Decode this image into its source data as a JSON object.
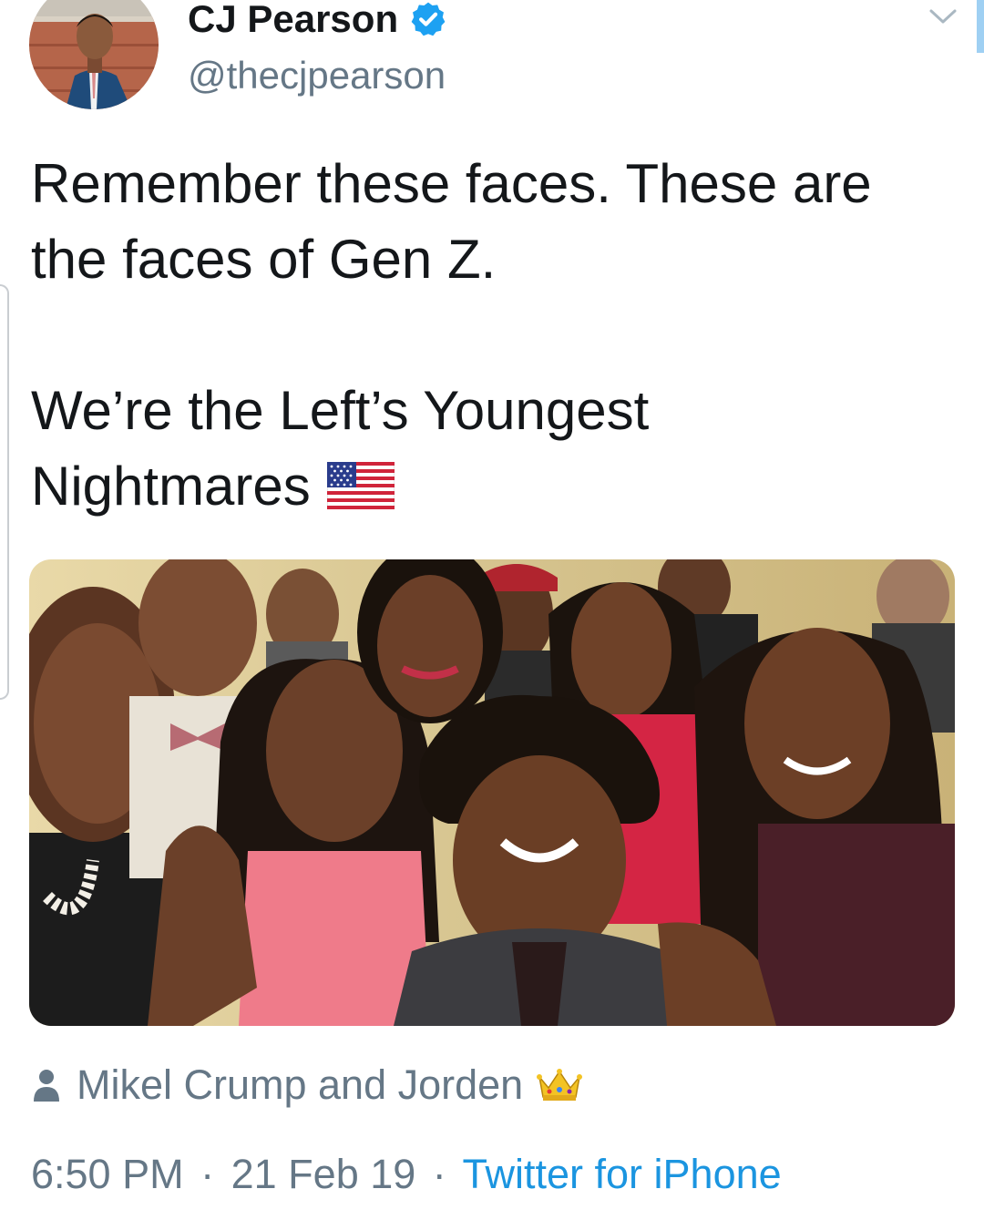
{
  "header": {
    "display_name": "CJ Pearson",
    "handle": "@thecjpearson",
    "avatar_icon": "profile-photo",
    "verified_icon": "verified-badge-icon",
    "menu_icon": "chevron-down-icon"
  },
  "tweet": {
    "line1": "Remember these faces. These are",
    "line2": "the faces of Gen Z.",
    "line3": "We’re the Left’s Youngest",
    "line4": "Nightmares",
    "emoji": "us-flag-emoji"
  },
  "media": {
    "tagged": "Mikel Crump and Jorden",
    "tag_icon": "person-icon",
    "tag_emoji": "crown-emoji"
  },
  "meta": {
    "time": "6:50 PM",
    "separator": "·",
    "date": "21 Feb 19",
    "source": "Twitter for iPhone"
  },
  "colors": {
    "primary_text": "#14171a",
    "secondary_text": "#657786",
    "link": "#1b95e0",
    "verified_blue": "#1da1f2"
  }
}
